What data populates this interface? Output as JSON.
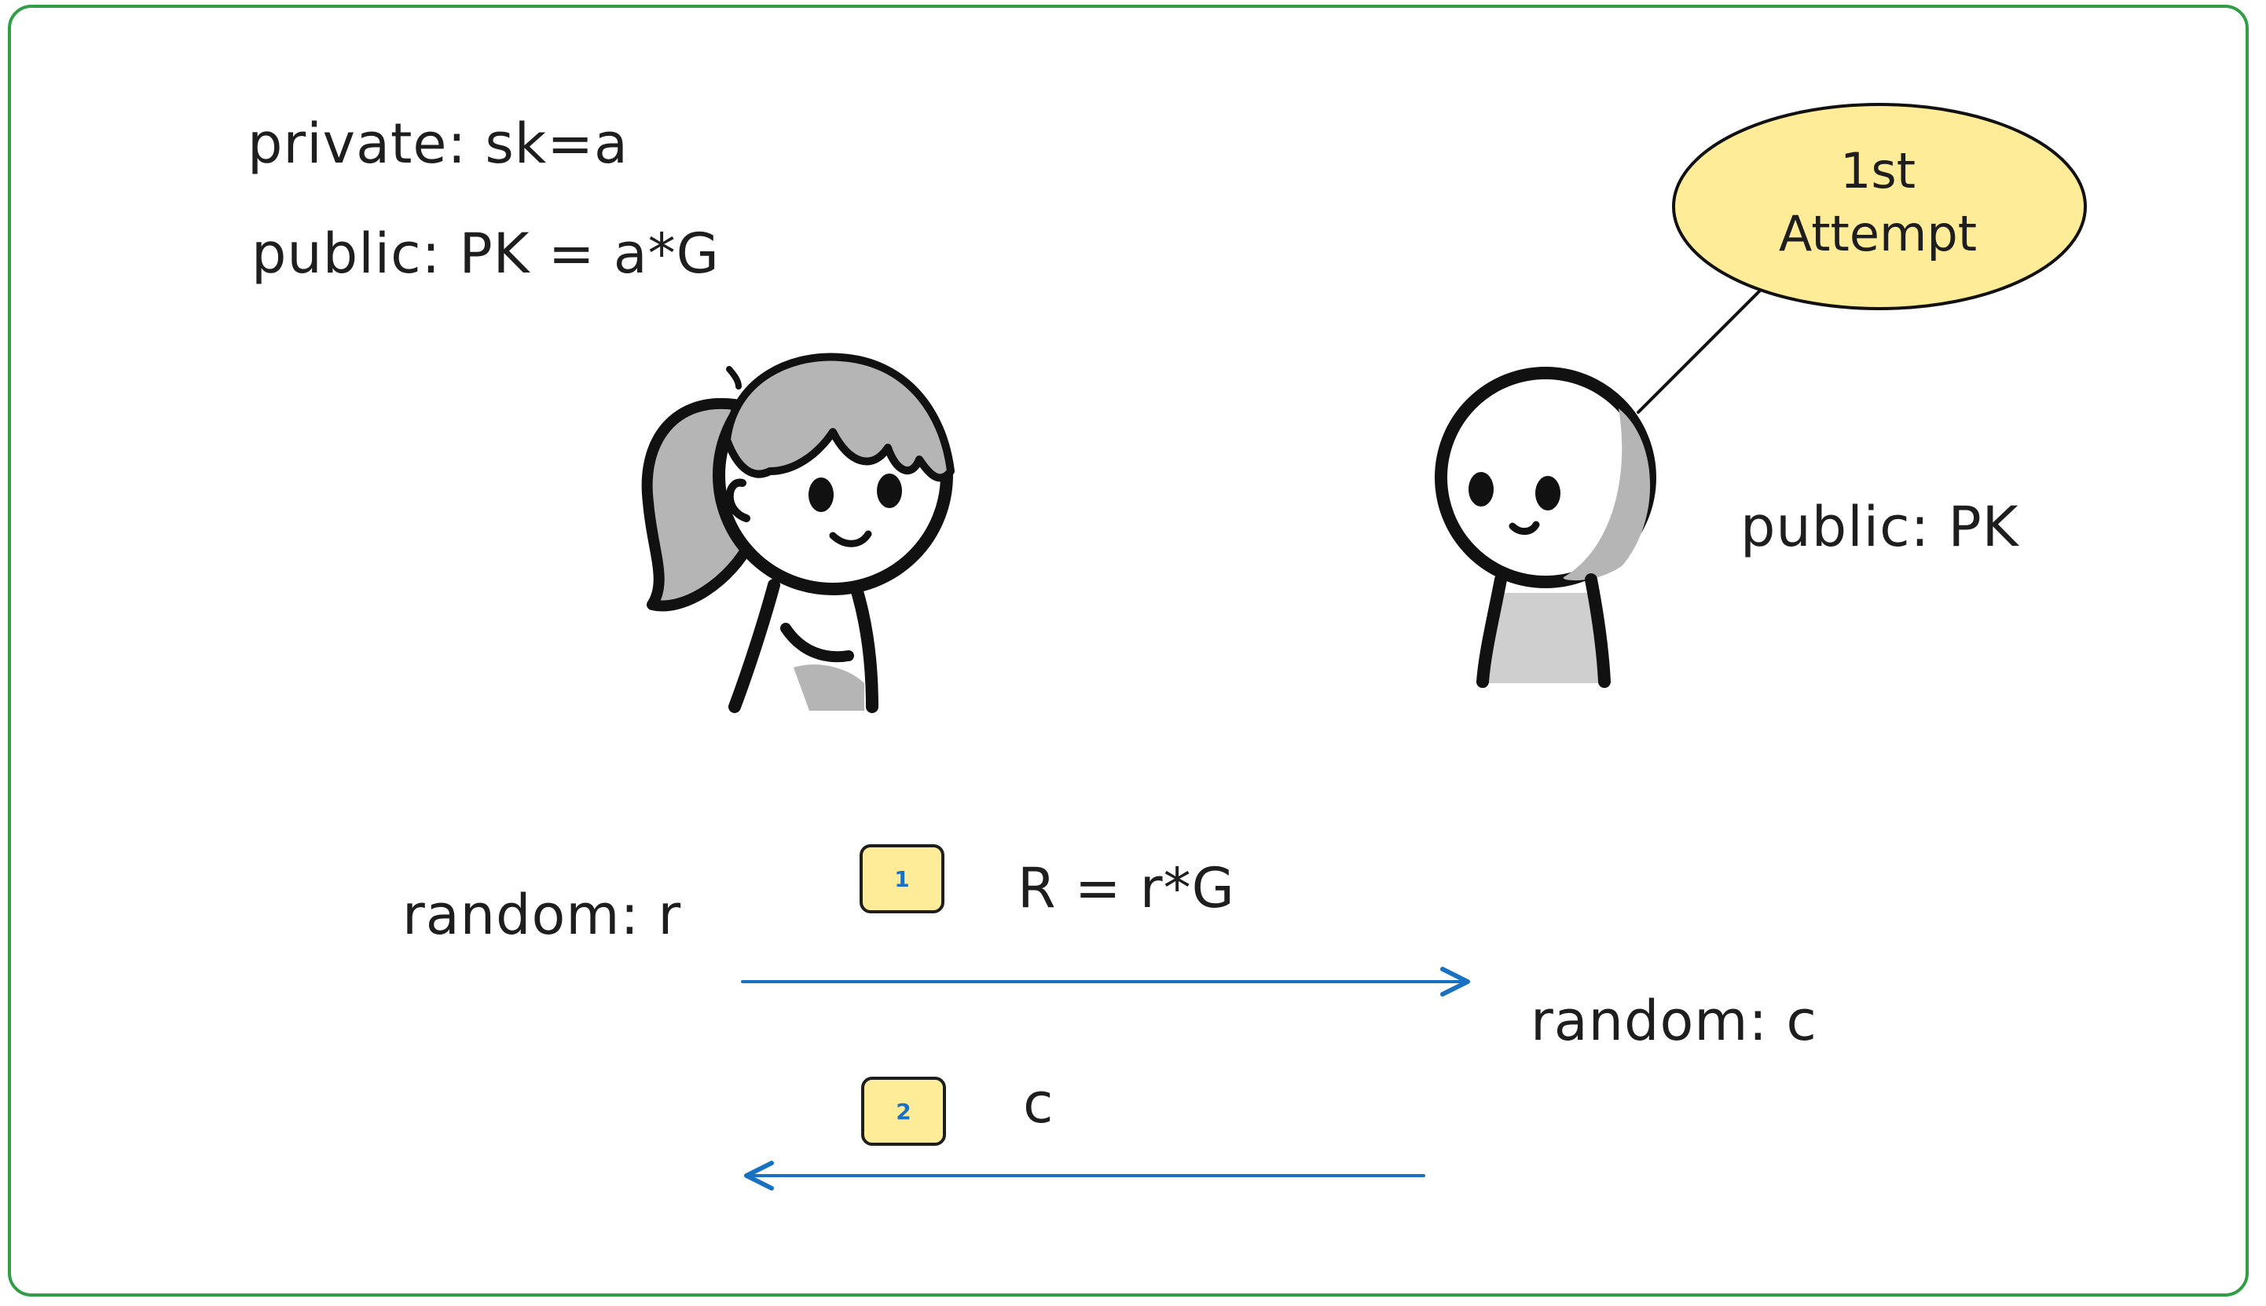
{
  "keys": {
    "private": "private: sk=a",
    "public": "public: PK = a*G"
  },
  "verifier": {
    "public": "public: PK",
    "bubble_line1": "1st",
    "bubble_line2": "Attempt"
  },
  "steps": [
    {
      "number": "1",
      "message": "R = r*G"
    },
    {
      "number": "2",
      "message": "c"
    }
  ],
  "prover_random": "random: r",
  "verifier_random": "random: c",
  "colors": {
    "frame": "#2f9e44",
    "arrow": "#1971c2",
    "highlight": "#ffec99",
    "ink": "#1e1e1e",
    "shade": "#b5b5b5"
  },
  "icons": [
    "girl-character-icon",
    "stick-figure-icon",
    "arrow-right-icon",
    "arrow-left-icon"
  ]
}
